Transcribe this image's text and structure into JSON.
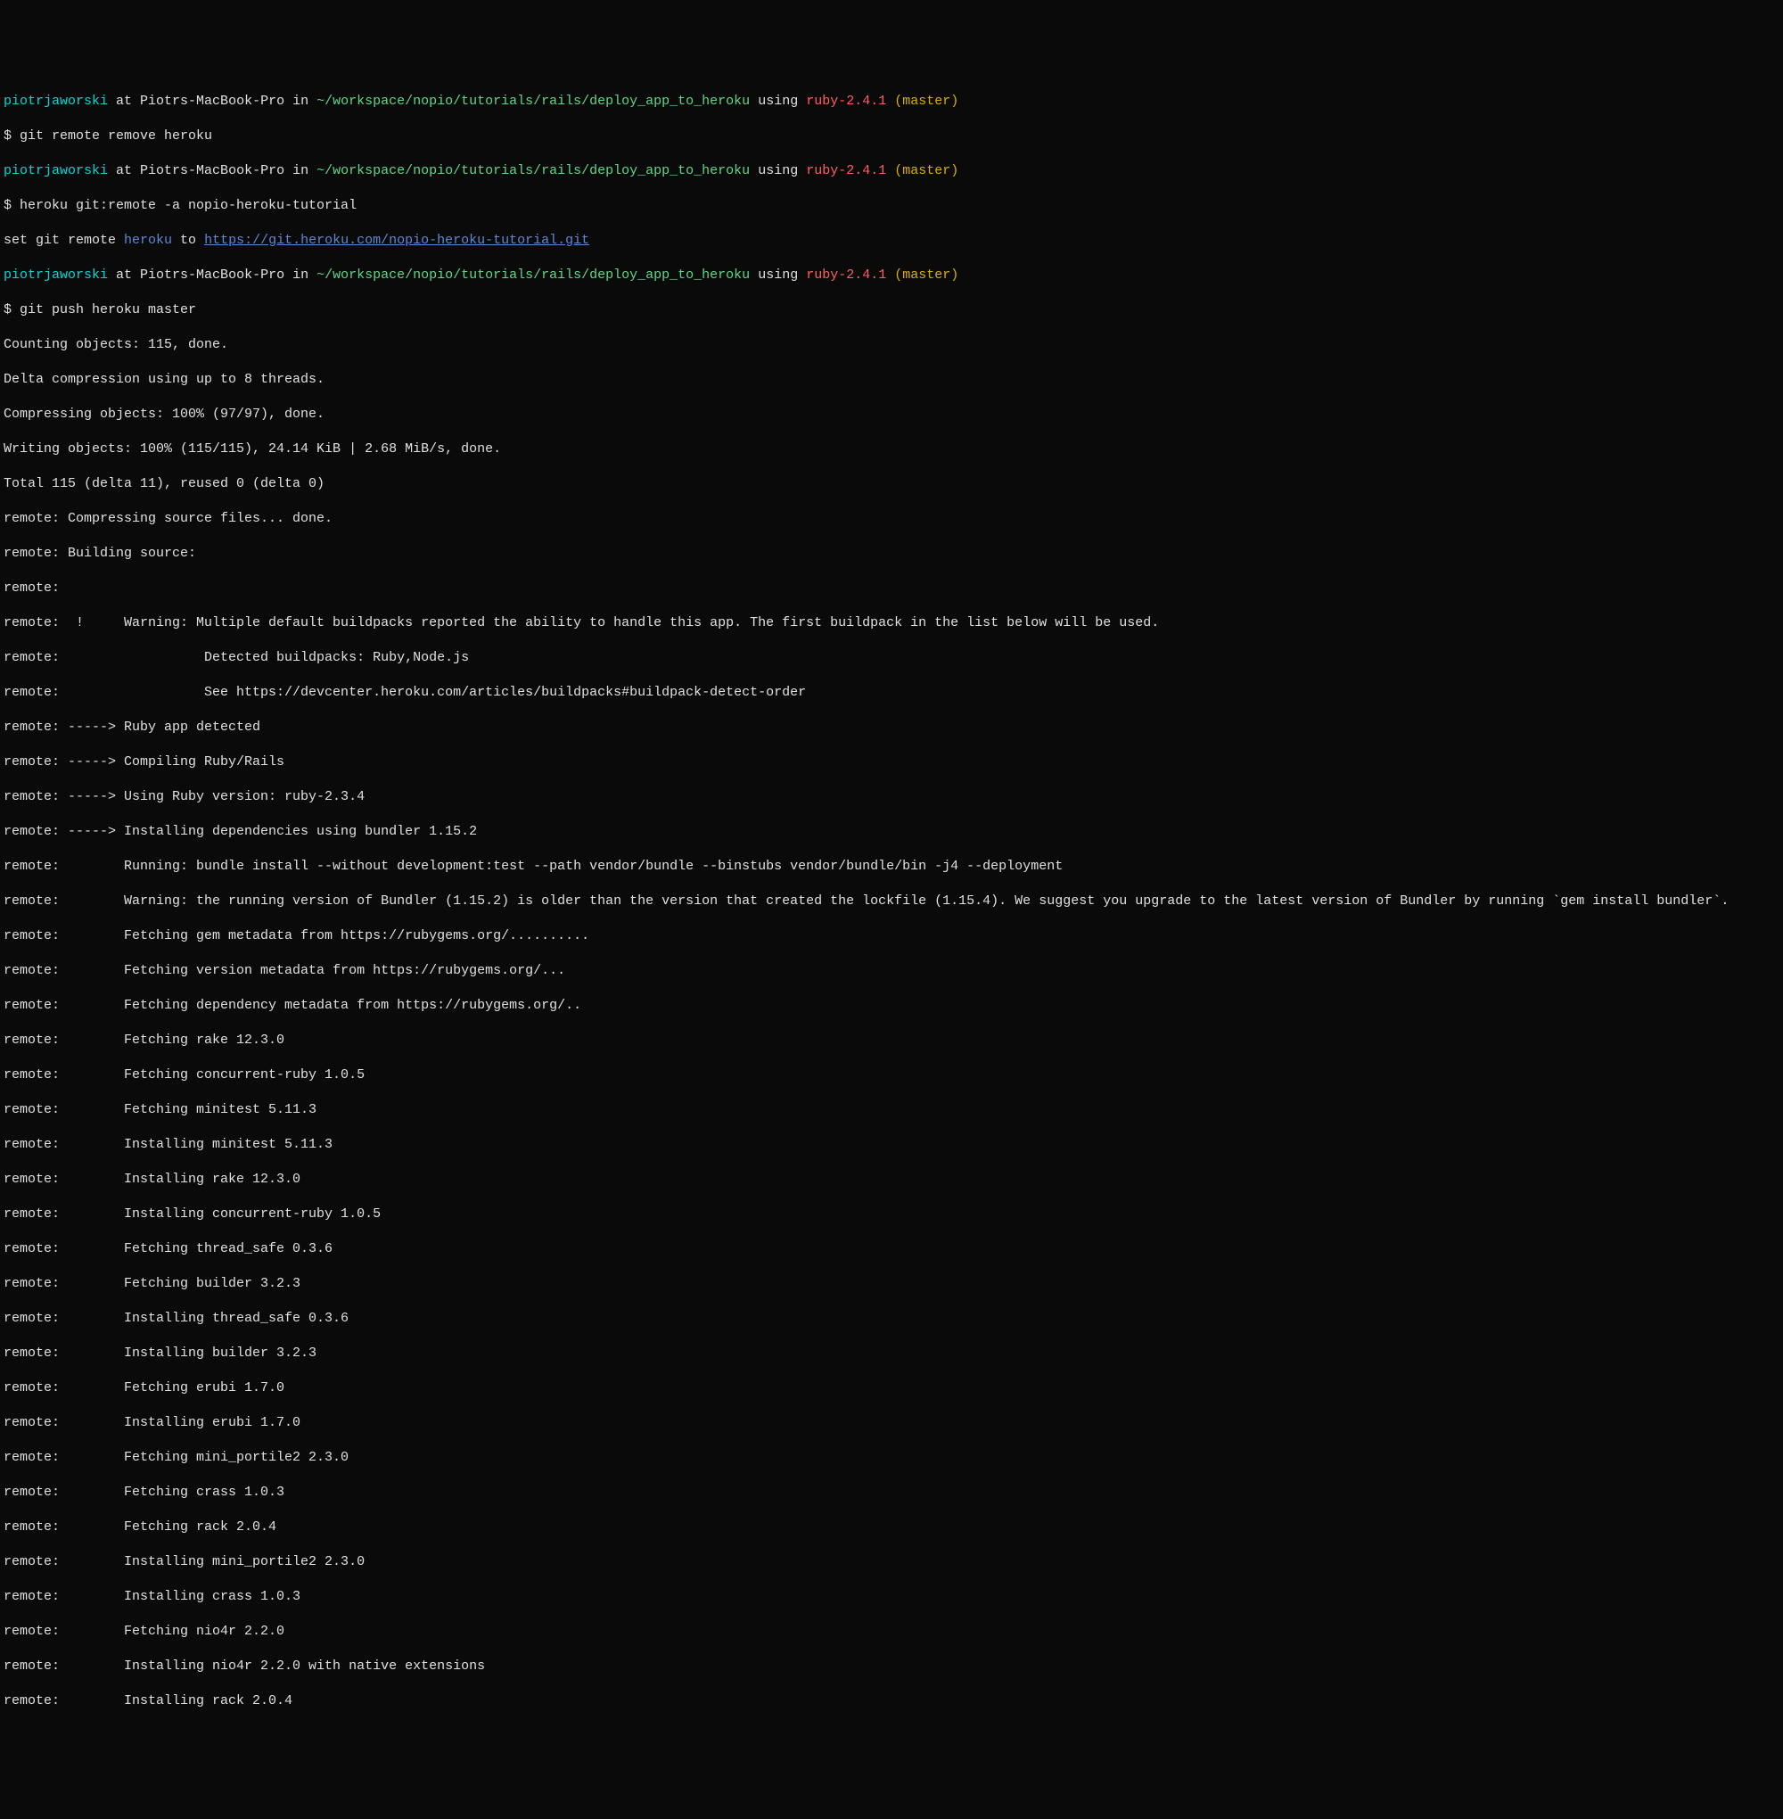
{
  "prompt1": {
    "user": "piotrjaworski",
    "at": " at ",
    "host": "Piotrs-MacBook-Pro",
    "in": " in ",
    "path": "~/workspace/nopio/tutorials/rails/deploy_app_to_heroku",
    "using": " using ",
    "ruby": "ruby-2.4.1",
    "branch": " (master)"
  },
  "cmd1": "$ git remote remove heroku",
  "prompt2": {
    "user": "piotrjaworski",
    "at": " at ",
    "host": "Piotrs-MacBook-Pro",
    "in": " in ",
    "path": "~/workspace/nopio/tutorials/rails/deploy_app_to_heroku",
    "using": " using ",
    "ruby": "ruby-2.4.1",
    "branch": " (master)"
  },
  "cmd2": "$ heroku git:remote -a nopio-heroku-tutorial",
  "setgit_pre": "set git remote ",
  "setgit_heroku": "heroku",
  "setgit_to": " to ",
  "setgit_url": "https://git.heroku.com/nopio-heroku-tutorial.git",
  "prompt3": {
    "user": "piotrjaworski",
    "at": " at ",
    "host": "Piotrs-MacBook-Pro",
    "in": " in ",
    "path": "~/workspace/nopio/tutorials/rails/deploy_app_to_heroku",
    "using": " using ",
    "ruby": "ruby-2.4.1",
    "branch": " (master)"
  },
  "cmd3": "$ git push heroku master",
  "out": {
    "l01": "Counting objects: 115, done.",
    "l02": "Delta compression using up to 8 threads.",
    "l03": "Compressing objects: 100% (97/97), done.",
    "l04": "Writing objects: 100% (115/115), 24.14 KiB | 2.68 MiB/s, done.",
    "l05": "Total 115 (delta 11), reused 0 (delta 0)",
    "l06": "remote: Compressing source files... done.",
    "l07": "remote: Building source:",
    "l08": "remote:",
    "l09": "remote:  !     Warning: Multiple default buildpacks reported the ability to handle this app. The first buildpack in the list below will be used.",
    "l10": "remote:                  Detected buildpacks: Ruby,Node.js",
    "l11": "remote:                  See https://devcenter.heroku.com/articles/buildpacks#buildpack-detect-order",
    "l12": "remote: -----> Ruby app detected",
    "l13": "remote: -----> Compiling Ruby/Rails",
    "l14": "remote: -----> Using Ruby version: ruby-2.3.4",
    "l15": "remote: -----> Installing dependencies using bundler 1.15.2",
    "l16": "remote:        Running: bundle install --without development:test --path vendor/bundle --binstubs vendor/bundle/bin -j4 --deployment",
    "l17": "remote:        Warning: the running version of Bundler (1.15.2) is older than the version that created the lockfile (1.15.4). We suggest you upgrade to the latest version of Bundler by running `gem install bundler`.",
    "l18": "remote:        Fetching gem metadata from https://rubygems.org/..........",
    "l19": "remote:        Fetching version metadata from https://rubygems.org/...",
    "l20": "remote:        Fetching dependency metadata from https://rubygems.org/..",
    "l21": "remote:        Fetching rake 12.3.0",
    "l22": "remote:        Fetching concurrent-ruby 1.0.5",
    "l23": "remote:        Fetching minitest 5.11.3",
    "l24": "remote:        Installing minitest 5.11.3",
    "l25": "remote:        Installing rake 12.3.0",
    "l26": "remote:        Installing concurrent-ruby 1.0.5",
    "l27": "remote:        Fetching thread_safe 0.3.6",
    "l28": "remote:        Fetching builder 3.2.3",
    "l29": "remote:        Installing thread_safe 0.3.6",
    "l30": "remote:        Installing builder 3.2.3",
    "l31": "remote:        Fetching erubi 1.7.0",
    "l32": "remote:        Installing erubi 1.7.0",
    "l33": "remote:        Fetching mini_portile2 2.3.0",
    "l34": "remote:        Fetching crass 1.0.3",
    "l35": "remote:        Fetching rack 2.0.4",
    "l36": "remote:        Installing mini_portile2 2.3.0",
    "l37": "remote:        Installing crass 1.0.3",
    "l38": "remote:        Fetching nio4r 2.2.0",
    "l39": "remote:        Installing nio4r 2.2.0 with native extensions",
    "l40": "remote:        Installing rack 2.0.4"
  }
}
